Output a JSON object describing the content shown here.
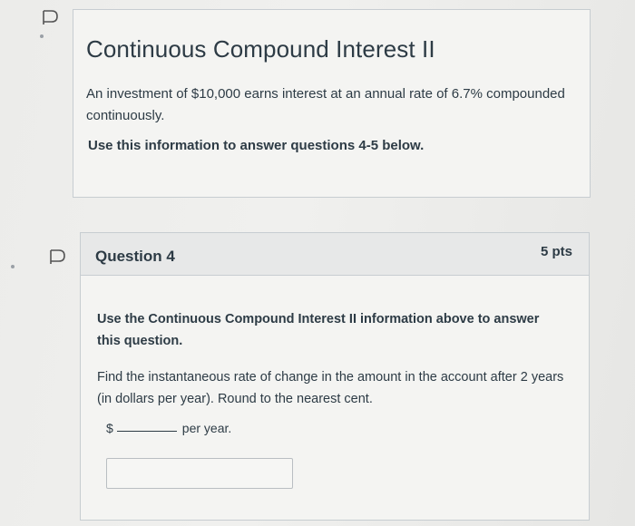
{
  "intro": {
    "title": "Continuous Compound Interest II",
    "text": "An investment of $10,000 earns interest at an annual rate of 6.7% compounded continuously.",
    "instructions": "Use this information to answer questions 4-5 below."
  },
  "question": {
    "name": "Question 4",
    "points": "5 pts",
    "reference": "Use the Continuous Compound Interest II information above to answer this question.",
    "prompt": "Find the instantaneous rate of change in the amount in the account after 2 years (in dollars per year). Round to the nearest cent.",
    "answer_prefix": "$",
    "answer_suffix": "per year.",
    "answer_value": ""
  },
  "icons": {
    "flag": "flag-icon",
    "accent": "#4a4a4a"
  }
}
